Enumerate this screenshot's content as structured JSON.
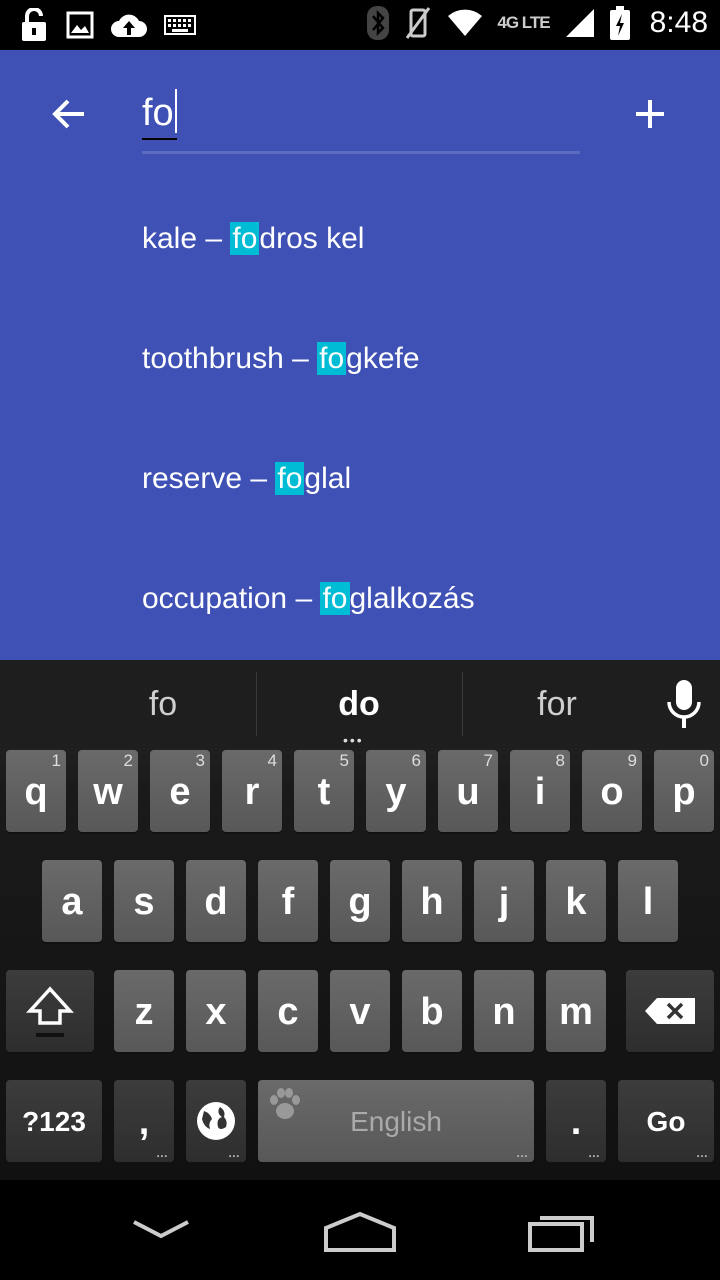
{
  "status_bar": {
    "time": "8:48",
    "network": "4G LTE",
    "icons_left": [
      "unlock-icon",
      "image-icon",
      "cloud-upload-icon",
      "keyboard-icon"
    ],
    "icons_right": [
      "bluetooth-icon",
      "vibrate-off-icon",
      "wifi-icon",
      "signal-icon",
      "battery-icon"
    ]
  },
  "search": {
    "value": "fo"
  },
  "results": [
    {
      "before": "kale – ",
      "match": "fo",
      "after": "dros kel"
    },
    {
      "before": "toothbrush – ",
      "match": "fo",
      "after": "gkefe"
    },
    {
      "before": "reserve – ",
      "match": "fo",
      "after": "glal"
    },
    {
      "before": "occupation – ",
      "match": "fo",
      "after": "glalkozás"
    }
  ],
  "keyboard": {
    "suggestions": [
      "fo",
      "do",
      "for"
    ],
    "row1": [
      {
        "ch": "q",
        "num": "1"
      },
      {
        "ch": "w",
        "num": "2"
      },
      {
        "ch": "e",
        "num": "3"
      },
      {
        "ch": "r",
        "num": "4"
      },
      {
        "ch": "t",
        "num": "5"
      },
      {
        "ch": "y",
        "num": "6"
      },
      {
        "ch": "u",
        "num": "7"
      },
      {
        "ch": "i",
        "num": "8"
      },
      {
        "ch": "o",
        "num": "9"
      },
      {
        "ch": "p",
        "num": "0"
      }
    ],
    "row2": [
      "a",
      "s",
      "d",
      "f",
      "g",
      "h",
      "j",
      "k",
      "l"
    ],
    "row3": [
      "z",
      "x",
      "c",
      "v",
      "b",
      "n",
      "m"
    ],
    "symbols_label": "?123",
    "comma_label": ",",
    "space_label": "English",
    "period_label": ".",
    "go_label": "Go"
  },
  "colors": {
    "app_bar": "#3f51b5",
    "highlight": "#00bcd4"
  }
}
